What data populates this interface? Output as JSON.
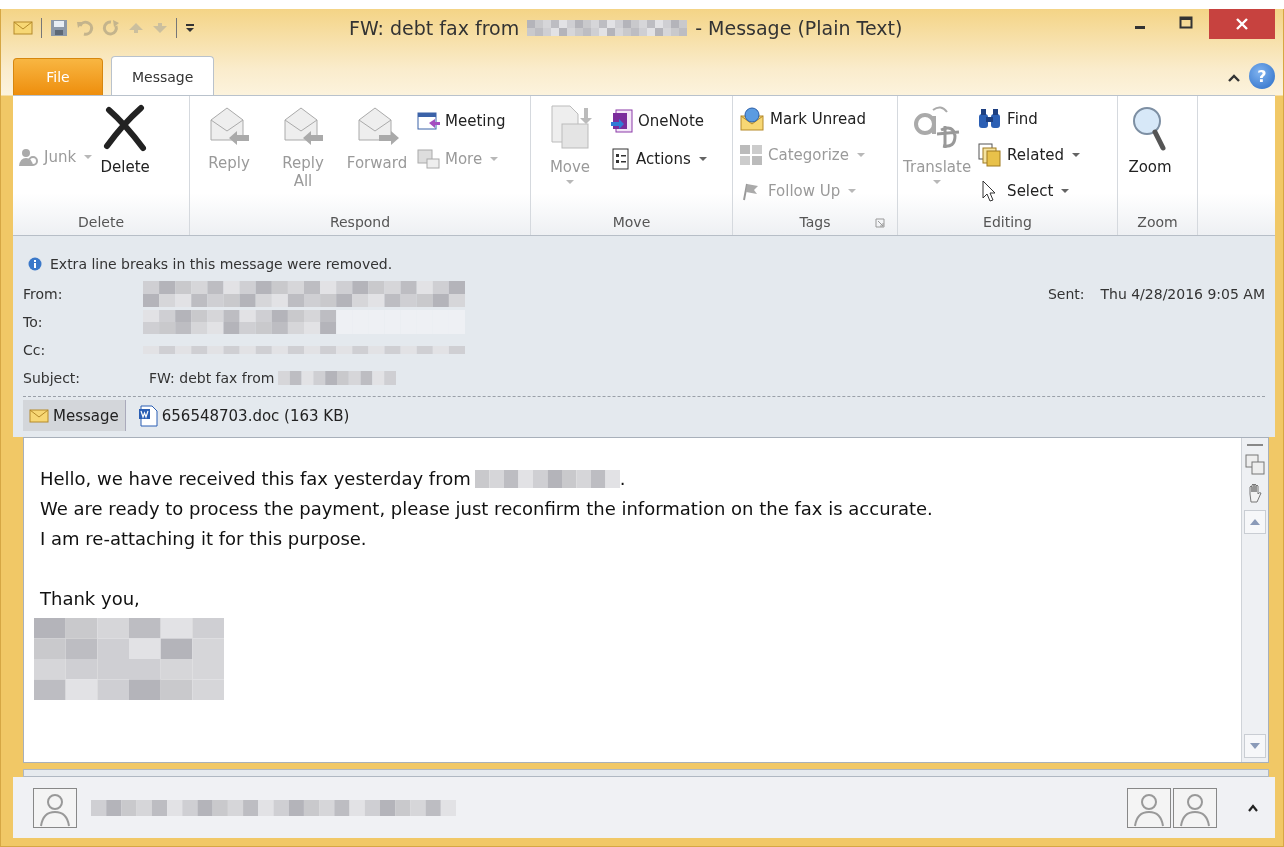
{
  "window": {
    "title_start": "FW: debt fax from",
    "title_end": "- Message (Plain Text)"
  },
  "tabs": [
    {
      "label": "File",
      "kind": "file",
      "selected": false
    },
    {
      "label": "Message",
      "kind": "tab",
      "selected": true
    }
  ],
  "help": "?",
  "ribbon": {
    "groups": [
      {
        "label": "Delete",
        "items": [
          {
            "label": "Junk",
            "disabled": true,
            "dropdown": true
          },
          {
            "label": "Delete",
            "disabled": false,
            "dropdown": false
          }
        ]
      },
      {
        "label": "Respond",
        "items": [
          {
            "label": "Reply",
            "disabled": true,
            "dropdown": false
          },
          {
            "label": "Reply All",
            "disabled": true,
            "dropdown": false
          },
          {
            "label": "Forward",
            "disabled": true,
            "dropdown": false
          },
          {
            "label": "Meeting",
            "disabled": false,
            "dropdown": false
          },
          {
            "label": "More",
            "disabled": true,
            "dropdown": true
          }
        ]
      },
      {
        "label": "Move",
        "items": [
          {
            "label": "Move",
            "disabled": true,
            "dropdown": true
          },
          {
            "label": "OneNote",
            "disabled": false,
            "dropdown": false
          },
          {
            "label": "Actions",
            "disabled": false,
            "dropdown": true
          }
        ]
      },
      {
        "label": "Tags",
        "items": [
          {
            "label": "Mark Unread",
            "disabled": false,
            "dropdown": false
          },
          {
            "label": "Categorize",
            "disabled": true,
            "dropdown": true
          },
          {
            "label": "Follow Up",
            "disabled": true,
            "dropdown": true
          }
        ]
      },
      {
        "label": "Editing",
        "items": [
          {
            "label": "Translate",
            "disabled": true,
            "dropdown": true
          },
          {
            "label": "Find",
            "disabled": false,
            "dropdown": false
          },
          {
            "label": "Related",
            "disabled": false,
            "dropdown": true
          },
          {
            "label": "Select",
            "disabled": false,
            "dropdown": true
          }
        ]
      },
      {
        "label": "Zoom",
        "items": [
          {
            "label": "Zoom",
            "disabled": false,
            "dropdown": false
          }
        ]
      }
    ]
  },
  "info_bar": "Extra line breaks in this message were removed.",
  "header": {
    "from_label": "From:",
    "to_label": "To:",
    "cc_label": "Cc:",
    "subject_label": "Subject:",
    "subject_start": "FW: debt fax from",
    "sent_label": "Sent:",
    "sent_value": "Thu 4/28/2016 9:05 AM"
  },
  "attachments": [
    {
      "label": "Message",
      "kind": "message",
      "selected": true
    },
    {
      "label": "656548703.doc (163 KB)",
      "kind": "file",
      "selected": false
    }
  ],
  "body": {
    "line_1_start": "Hello, we have received this fax yesterday from",
    "line_1_end": ".",
    "lines": [
      "We are ready to process the payment, please just reconfirm the information on the fax is accurate.",
      "I am re-attaching it for this purpose."
    ],
    "closing": "Thank you,"
  }
}
